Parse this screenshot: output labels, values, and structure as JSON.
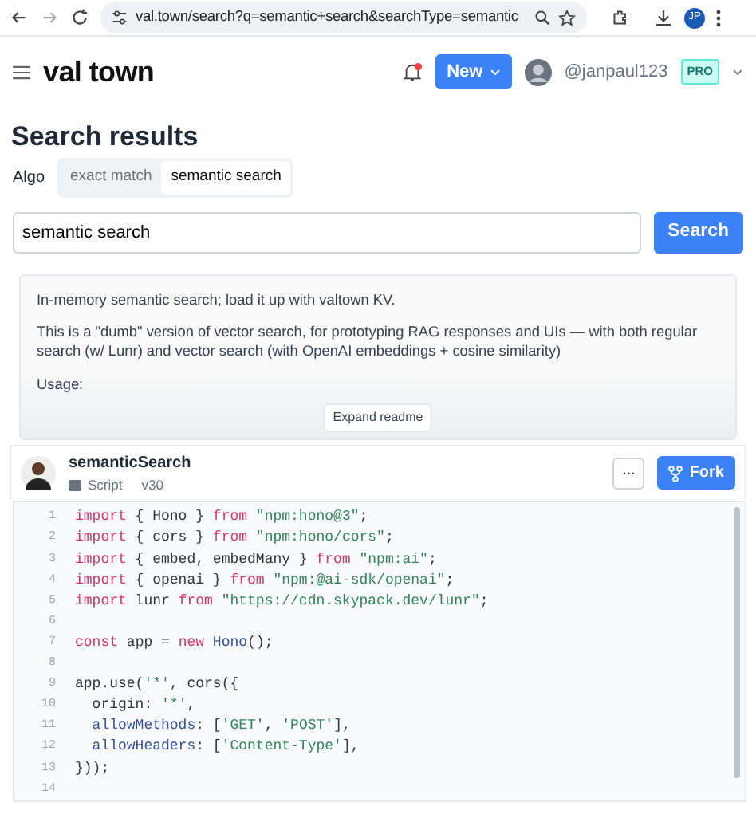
{
  "browser": {
    "url": "val.town/search?q=semantic+search&searchType=semantic",
    "profile": "JP"
  },
  "header": {
    "logo": "val town",
    "notification": true,
    "new_button": "New",
    "username": "@janpaul123",
    "plan_badge": "PRO"
  },
  "page_title": "Search results",
  "algo": {
    "label": "Algo",
    "options": [
      {
        "label": "exact match",
        "selected": false
      },
      {
        "label": "semantic search",
        "selected": true
      }
    ]
  },
  "search": {
    "value": "semantic search",
    "button": "Search"
  },
  "readme": {
    "paragraphs": [
      "In-memory semantic search; load it up with valtown KV.",
      "This is a \"dumb\" version of vector search, for prototyping RAG responses and UIs — with both regular search (w/ Lunr) and vector search (with OpenAI embeddings + cosine similarity)",
      "Usage:"
    ],
    "expand_button": "Expand readme"
  },
  "val": {
    "name": "semanticSearch",
    "type": "Script",
    "version": "v30",
    "more_button": "···",
    "fork_button": "Fork",
    "code": [
      {
        "number": "1",
        "tokens": [
          {
            "kind": "keyword",
            "text": "import"
          },
          {
            "kind": "plain",
            "text": " { Hono } "
          },
          {
            "kind": "keyword",
            "text": "from"
          },
          {
            "kind": "string",
            "text": " \"npm:hono@3\""
          },
          {
            "kind": "plain",
            "text": ";"
          }
        ]
      },
      {
        "number": "2",
        "tokens": [
          {
            "kind": "keyword",
            "text": "import"
          },
          {
            "kind": "plain",
            "text": " { cors } "
          },
          {
            "kind": "keyword",
            "text": "from"
          },
          {
            "kind": "string",
            "text": " \"npm:hono/cors\""
          },
          {
            "kind": "plain",
            "text": ";"
          }
        ]
      },
      {
        "number": "3",
        "tokens": [
          {
            "kind": "keyword",
            "text": "import"
          },
          {
            "kind": "plain",
            "text": " { embed, embedMany } "
          },
          {
            "kind": "keyword",
            "text": "from"
          },
          {
            "kind": "string",
            "text": " \"npm:ai\""
          },
          {
            "kind": "plain",
            "text": ";"
          }
        ]
      },
      {
        "number": "4",
        "tokens": [
          {
            "kind": "keyword",
            "text": "import"
          },
          {
            "kind": "plain",
            "text": " { openai } "
          },
          {
            "kind": "keyword",
            "text": "from"
          },
          {
            "kind": "string",
            "text": " \"npm:@ai-sdk/openai\""
          },
          {
            "kind": "plain",
            "text": ";"
          }
        ]
      },
      {
        "number": "5",
        "tokens": [
          {
            "kind": "keyword",
            "text": "import"
          },
          {
            "kind": "plain",
            "text": " lunr "
          },
          {
            "kind": "keyword",
            "text": "from"
          },
          {
            "kind": "string",
            "text": " \"https://cdn.skypack.dev/lunr\""
          },
          {
            "kind": "plain",
            "text": ";"
          }
        ]
      },
      {
        "number": "6"
      },
      {
        "number": "7",
        "tokens": [
          {
            "kind": "keyword",
            "text": "const"
          },
          {
            "kind": "plain",
            "text": " app = "
          },
          {
            "kind": "keyword",
            "text": "new"
          },
          {
            "kind": "type",
            "text": " Hono"
          },
          {
            "kind": "plain",
            "text": "();"
          }
        ]
      },
      {
        "number": "8"
      },
      {
        "number": "9",
        "tokens": [
          {
            "kind": "plain",
            "text": "app.use("
          },
          {
            "kind": "string",
            "text": "'*'"
          },
          {
            "kind": "plain",
            "text": ", cors({"
          }
        ]
      },
      {
        "number": "10",
        "tokens": [
          {
            "kind": "plain",
            "text": "  origin: "
          },
          {
            "kind": "string",
            "text": "'*'"
          },
          {
            "kind": "plain",
            "text": ","
          }
        ]
      },
      {
        "number": "11",
        "tokens": [
          {
            "kind": "property",
            "text": "  allowMethods"
          },
          {
            "kind": "plain",
            "text": ": ["
          },
          {
            "kind": "string",
            "text": "'GET'"
          },
          {
            "kind": "plain",
            "text": ", "
          },
          {
            "kind": "string",
            "text": "'POST'"
          },
          {
            "kind": "plain",
            "text": "],"
          }
        ]
      },
      {
        "number": "12",
        "tokens": [
          {
            "kind": "property",
            "text": "  allowHeaders"
          },
          {
            "kind": "plain",
            "text": ": ["
          },
          {
            "kind": "string",
            "text": "'Content-Type'"
          },
          {
            "kind": "plain",
            "text": "],"
          }
        ]
      },
      {
        "number": "13",
        "tokens": [
          {
            "kind": "plain",
            "text": "}));"
          }
        ]
      },
      {
        "number": "14"
      }
    ]
  }
}
